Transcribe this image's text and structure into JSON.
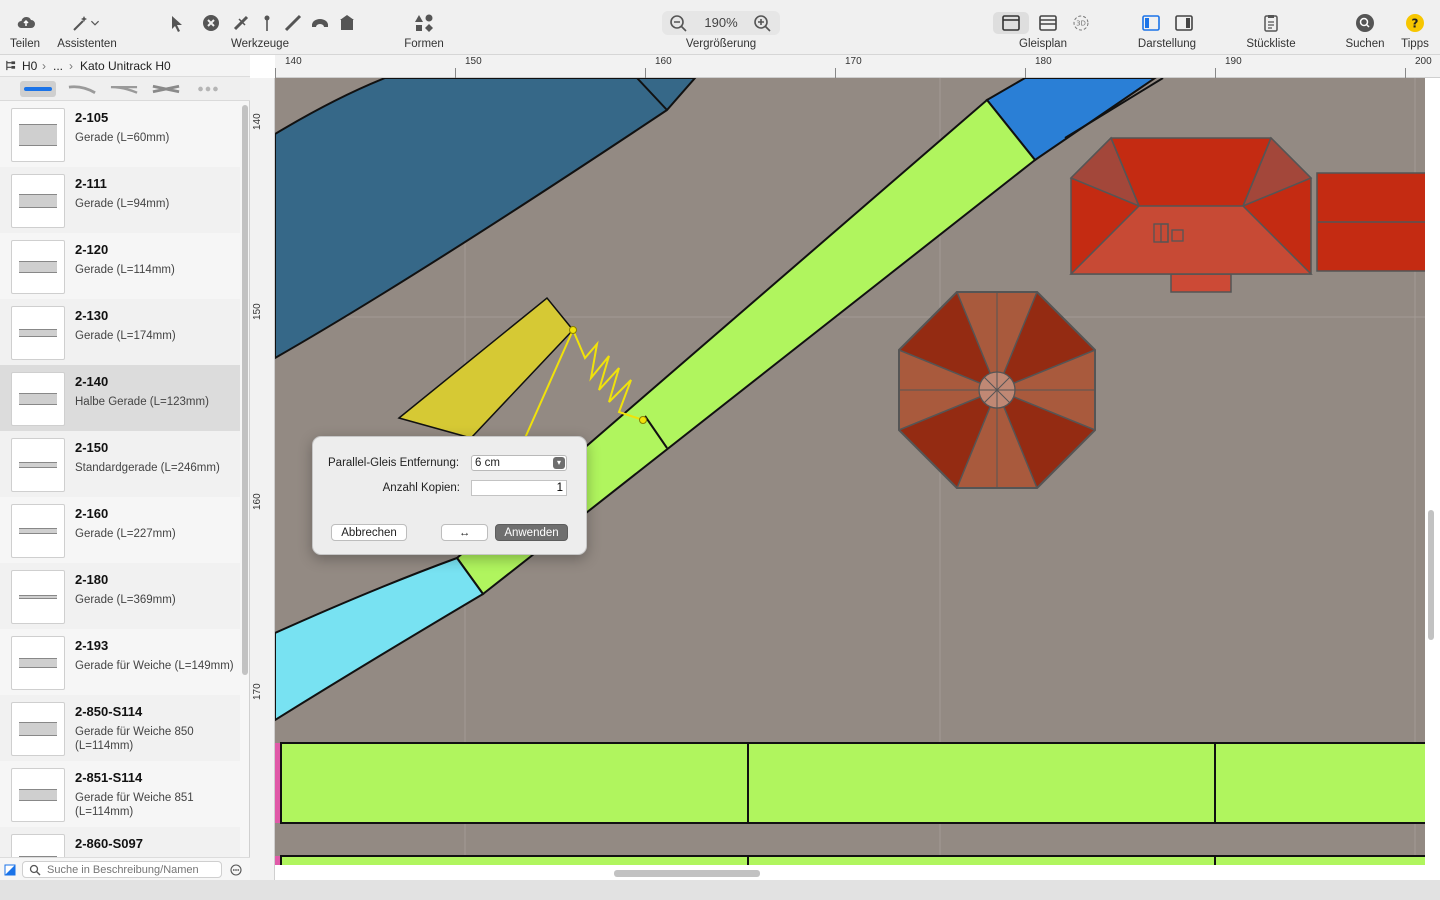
{
  "toolbar": {
    "share_label": "Teilen",
    "assistants_label": "Assistenten",
    "tools_label": "Werkzeuge",
    "shapes_label": "Formen",
    "zoom_label": "Vergrößerung",
    "zoom_value": "190%",
    "trackplan_label": "Gleisplan",
    "view_label": "Darstellung",
    "parts_list_label": "Stückliste",
    "search_label": "Suchen",
    "tips_label": "Tipps",
    "tips_glyph": "?",
    "threed_label": "3D",
    "accent_color": "#1a73e8",
    "tips_color": "#f7c600"
  },
  "breadcrumb": {
    "root": "H0",
    "ellipsis": "...",
    "current": "Kato Unitrack H0"
  },
  "track_types": [
    "straight",
    "curve",
    "switch",
    "crossing",
    "more"
  ],
  "track_list": [
    {
      "code": "2-105",
      "desc": "Gerade  (L=60mm)"
    },
    {
      "code": "2-111",
      "desc": "Gerade  (L=94mm)"
    },
    {
      "code": "2-120",
      "desc": "Gerade  (L=114mm)"
    },
    {
      "code": "2-130",
      "desc": "Gerade  (L=174mm)"
    },
    {
      "code": "2-140",
      "desc": "Halbe Gerade  (L=123mm)"
    },
    {
      "code": "2-150",
      "desc": "Standardgerade  (L=246mm)"
    },
    {
      "code": "2-160",
      "desc": "Gerade  (L=227mm)"
    },
    {
      "code": "2-180",
      "desc": "Gerade  (L=369mm)"
    },
    {
      "code": "2-193",
      "desc": "Gerade für Weiche (L=149mm)"
    },
    {
      "code": "2-850-S114",
      "desc": "Gerade für Weiche 850 (L=114mm)"
    },
    {
      "code": "2-851-S114",
      "desc": "Gerade für Weiche 851 (L=114mm)"
    },
    {
      "code": "2-860-S097",
      "desc": ""
    }
  ],
  "selected_index": 4,
  "search": {
    "placeholder": "Suche in Beschreibung/Namen"
  },
  "ruler": {
    "top": [
      "140",
      "150",
      "160",
      "170",
      "180",
      "190",
      "200"
    ],
    "left": [
      "140",
      "150",
      "160",
      "170"
    ]
  },
  "dialog": {
    "distance_label": "Parallel-Gleis Entfernung:",
    "distance_value": "6 cm",
    "copies_label": "Anzahl Kopien:",
    "copies_value": "1",
    "cancel_label": "Abbrechen",
    "swap_label": "↔",
    "apply_label": "Anwenden"
  },
  "colors": {
    "ground": "#938a83",
    "track_green": "#b0f55e",
    "track_blue_dark": "#366888",
    "track_blue": "#2a7fd6",
    "track_cyan": "#78e2f2",
    "track_yellow": "#d6c934",
    "roof_red": "#c42b12",
    "umbrella": "#a3402a"
  }
}
